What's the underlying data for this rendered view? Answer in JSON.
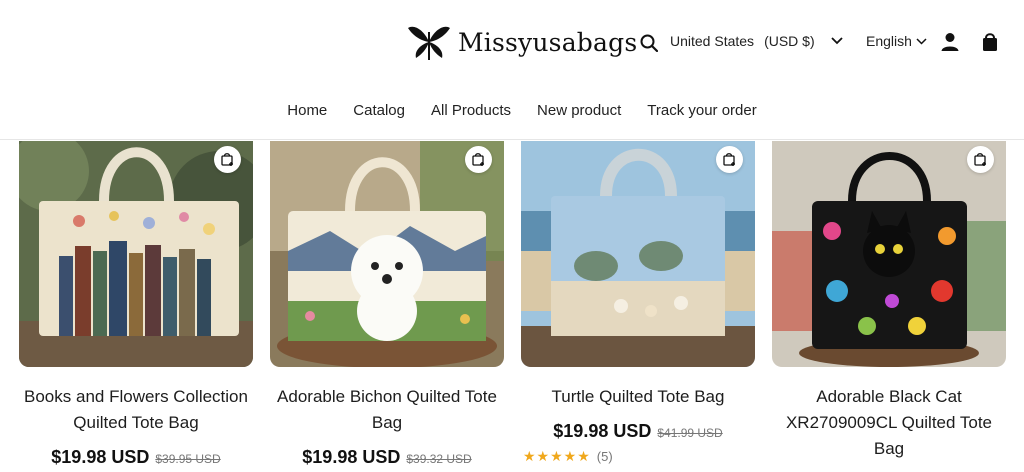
{
  "header": {
    "brand": "Missyusabags",
    "country_label": "United States",
    "currency_label": "(USD $)",
    "language_label": "English"
  },
  "nav": {
    "items": [
      "Home",
      "Catalog",
      "All Products",
      "New product",
      "Track your order"
    ]
  },
  "products": [
    {
      "title": "Books and Flowers Collection Quilted Tote Bag",
      "price": "$19.98 USD",
      "compare_price": "$39.95 USD"
    },
    {
      "title": "Adorable Bichon Quilted Tote Bag",
      "price": "$19.98 USD",
      "compare_price": "$39.32 USD"
    },
    {
      "title": "Turtle Quilted Tote Bag",
      "price": "$19.98 USD",
      "compare_price": "$41.99 USD",
      "rating_stars": "★★★★★",
      "rating_value": 4.6,
      "rating_count": "(5)"
    },
    {
      "title": "Adorable Black Cat XR2709009CL Quilted Tote Bag",
      "price": "",
      "compare_price": ""
    }
  ],
  "colors": {
    "text": "#1a1a1a",
    "accent_star": "#f0a81c",
    "muted": "#777777"
  },
  "icons": [
    "search-icon",
    "chevron-down-icon",
    "account-icon",
    "cart-icon",
    "quick-add-bag-icon",
    "butterfly-logo-icon"
  ]
}
